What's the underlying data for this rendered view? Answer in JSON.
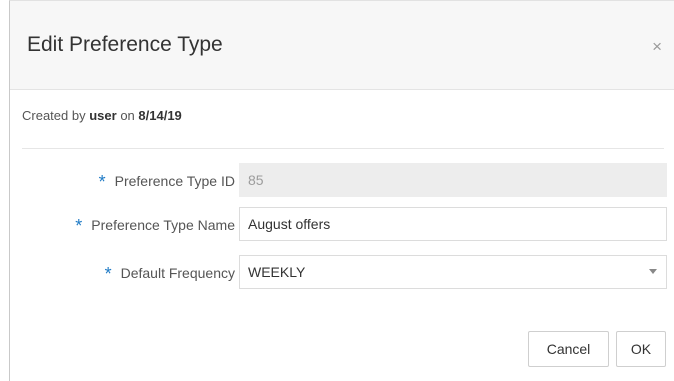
{
  "dialog": {
    "title": "Edit Preference Type",
    "close_glyph": "×",
    "close_icon": "close-icon"
  },
  "meta": {
    "created_by_prefix": "Created by",
    "user": "user",
    "on_text": "on",
    "date": "8/14/19"
  },
  "form": {
    "required_marker": "*",
    "required_color": "#1f7ac5",
    "fields": [
      {
        "label": "Preference Type ID",
        "value": "85",
        "readonly": true
      },
      {
        "label": "Preference Type Name",
        "value": "August offers",
        "readonly": false
      },
      {
        "label": "Default Frequency",
        "value": "WEEKLY",
        "type": "select",
        "dropdown_icon": "chevron-down-icon"
      }
    ]
  },
  "buttons": {
    "cancel": "Cancel",
    "ok": "OK"
  }
}
